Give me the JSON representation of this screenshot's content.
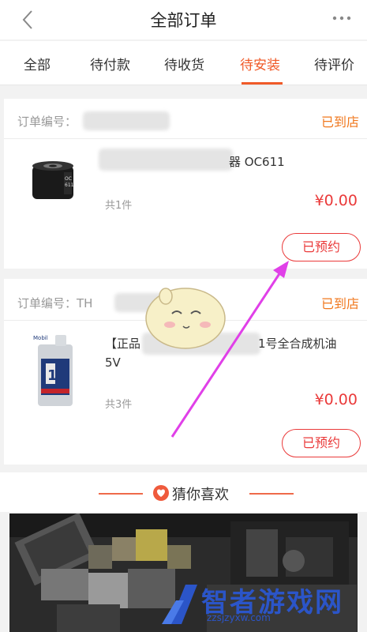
{
  "header": {
    "title": "全部订单"
  },
  "tabs": [
    {
      "label": "全部"
    },
    {
      "label": "待付款"
    },
    {
      "label": "待收货"
    },
    {
      "label": "待安装"
    },
    {
      "label": "待评价"
    }
  ],
  "active_tab": "待安装",
  "orders": [
    {
      "order_no_label": "订单编号：",
      "status": "已到店",
      "product_name": "器 OC611",
      "quantity": "共1件",
      "price": "¥0.00",
      "action": "已预约"
    },
    {
      "order_no_label": "订单编号：TH",
      "status": "已到店",
      "product_name_line1": "【正品",
      "product_name_line1_tail": "1号全合成机油",
      "product_name_line2": "5V",
      "product_brand": "Mobil",
      "quantity": "共3件",
      "price": "¥0.00",
      "action": "已预约"
    }
  ],
  "recommend": {
    "title": "猜你喜欢"
  },
  "watermark": {
    "title": "智者游戏网",
    "sub": "zzsjzyxw.com"
  },
  "colors": {
    "accent": "#f05a28",
    "price": "#ea3a3a",
    "status": "#f0781e",
    "arrow": "#e040e8"
  }
}
